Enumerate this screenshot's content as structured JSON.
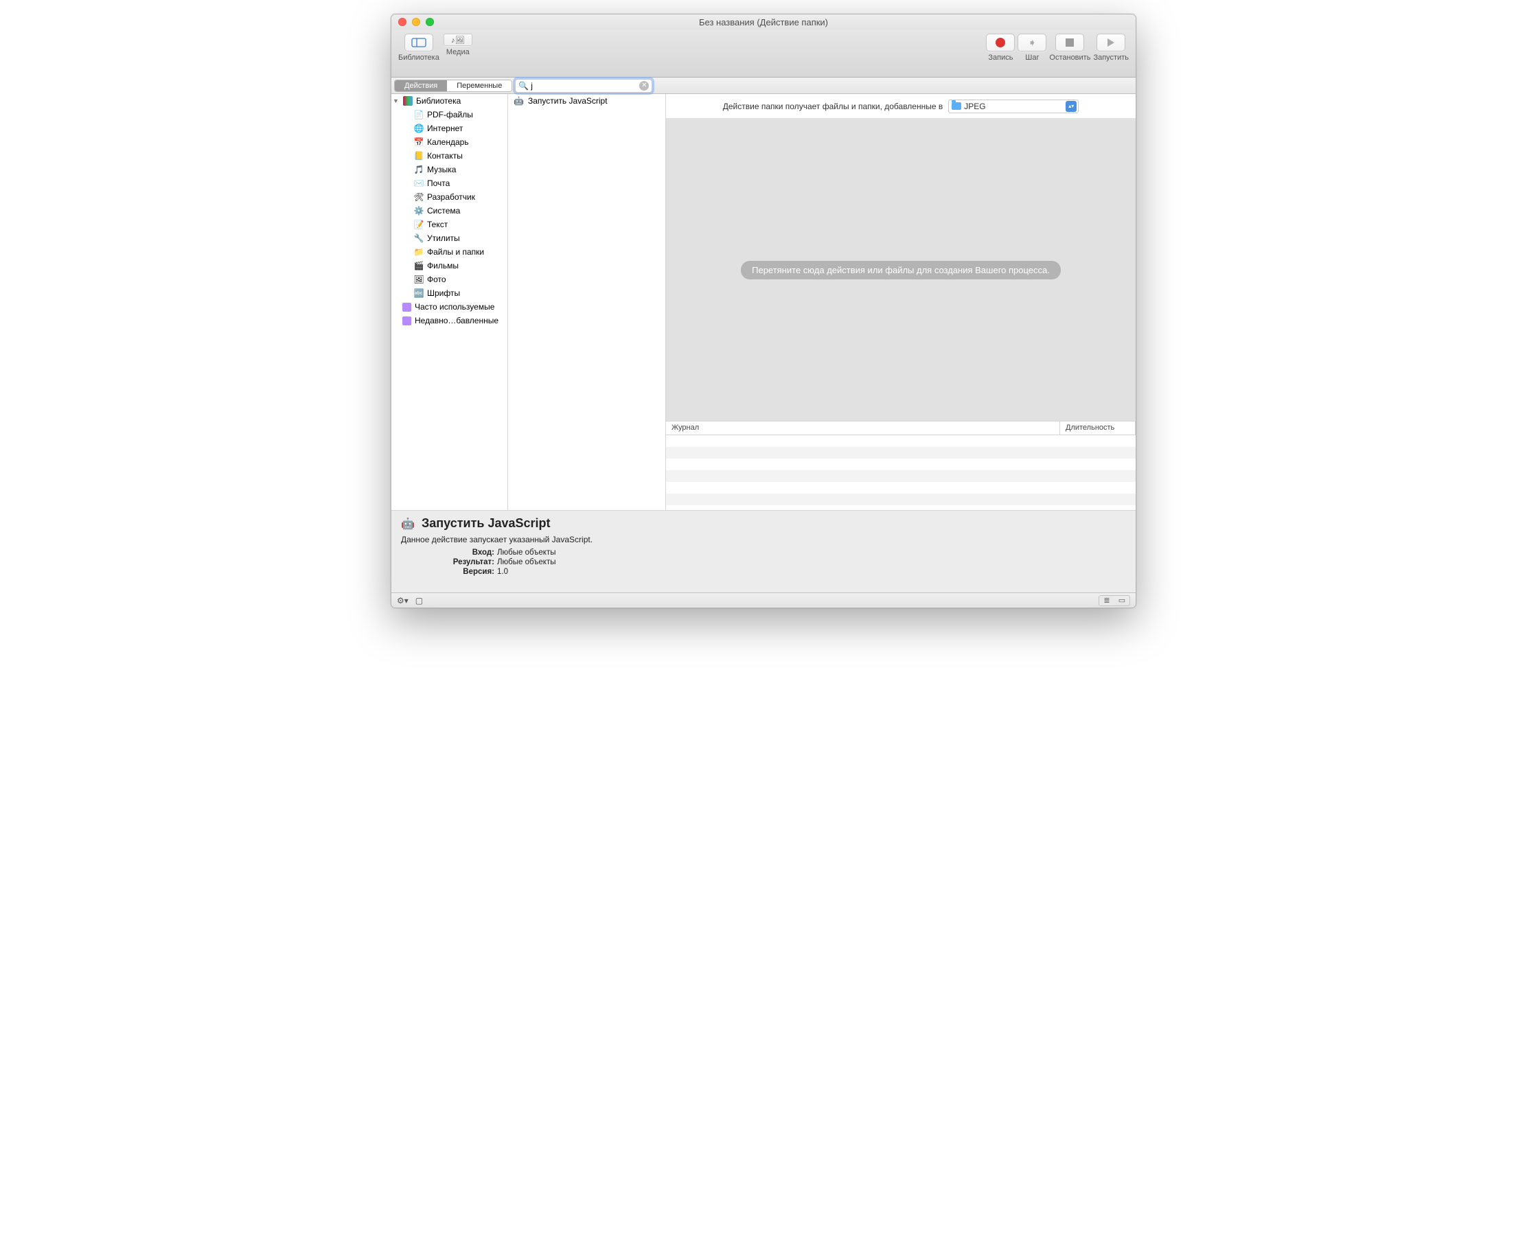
{
  "window": {
    "title": "Без названия (Действие папки)"
  },
  "toolbar": {
    "left": [
      {
        "label": "Библиотека",
        "icon": "library"
      },
      {
        "label": "Медиа",
        "icon": "media"
      }
    ],
    "right": [
      {
        "label": "Запись",
        "icon": "record"
      },
      {
        "label": "Шаг",
        "icon": "step"
      },
      {
        "label": "Остановить",
        "icon": "stop"
      },
      {
        "label": "Запустить",
        "icon": "run"
      }
    ]
  },
  "tabs": {
    "actions": "Действия",
    "variables": "Переменные",
    "active": "actions"
  },
  "search": {
    "value": "j"
  },
  "library": {
    "root": "Библиотека",
    "items": [
      {
        "label": "PDF-файлы",
        "icon": "📄"
      },
      {
        "label": "Интернет",
        "icon": "🌐"
      },
      {
        "label": "Календарь",
        "icon": "📅"
      },
      {
        "label": "Контакты",
        "icon": "📒"
      },
      {
        "label": "Музыка",
        "icon": "🎵"
      },
      {
        "label": "Почта",
        "icon": "✉️"
      },
      {
        "label": "Разработчик",
        "icon": "🛠"
      },
      {
        "label": "Система",
        "icon": "⚙️"
      },
      {
        "label": "Текст",
        "icon": "📝"
      },
      {
        "label": "Утилиты",
        "icon": "🔧"
      },
      {
        "label": "Файлы и папки",
        "icon": "📁"
      },
      {
        "label": "Фильмы",
        "icon": "🎬"
      },
      {
        "label": "Фото",
        "icon": "🖼"
      },
      {
        "label": "Шрифты",
        "icon": "🔤"
      }
    ],
    "smart": [
      "Часто используемые",
      "Недавно…бавленные"
    ]
  },
  "actions_list": [
    "Запустить JavaScript"
  ],
  "workflow": {
    "header_text": "Действие папки получает файлы и папки, добавленные в",
    "folder_selected": "JPEG",
    "placeholder": "Перетяните сюда действия или файлы для создания Вашего процесса."
  },
  "log": {
    "col1": "Журнал",
    "col2": "Длительность",
    "rows": 6
  },
  "description": {
    "title": "Запустить JavaScript",
    "subtitle": "Данное действие запускает указанный JavaScript.",
    "fields": [
      {
        "k": "Вход:",
        "v": "Любые объекты"
      },
      {
        "k": "Результат:",
        "v": "Любые объекты"
      },
      {
        "k": "Версия:",
        "v": "1.0"
      }
    ]
  }
}
